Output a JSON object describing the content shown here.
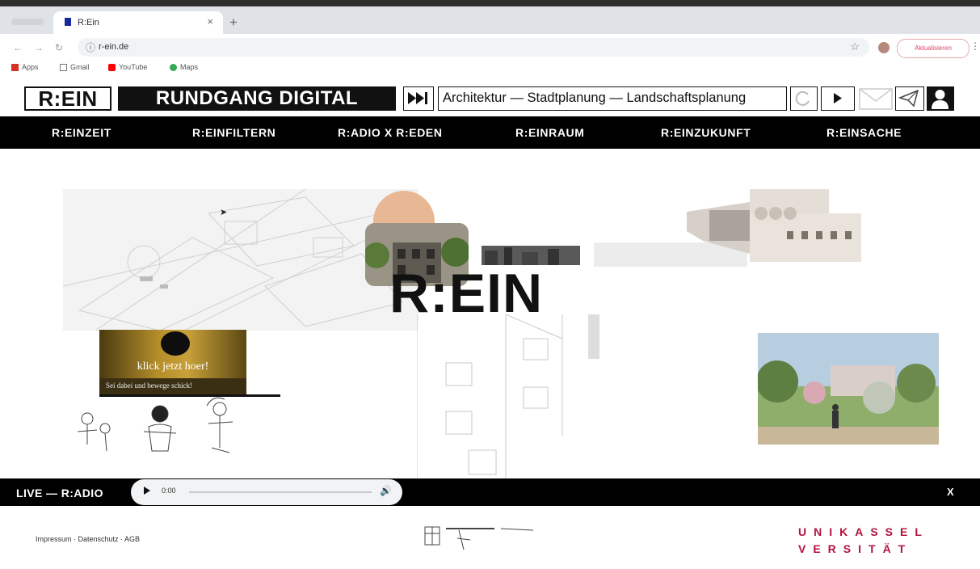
{
  "browser": {
    "tab_title": "R:Ein",
    "tab_close": "×",
    "new_tab": "+",
    "url": "r-ein.de",
    "update_button": "Aktualisieren",
    "bookmarks": [
      {
        "label": "Apps",
        "color": "#d93025"
      },
      {
        "label": "Gmail",
        "color": "#555555"
      },
      {
        "label": "YouTube",
        "color": "#ff0000"
      },
      {
        "label": "Maps",
        "color": "#34a853"
      }
    ]
  },
  "header": {
    "logo": "R:EIN",
    "title": "RUNDGANG DIGITAL",
    "marquee": "Architektur — Stadtplanung — Landschaftsplanung"
  },
  "nav": {
    "items": [
      "R:EINZEIT",
      "R:EINFILTERN",
      "R:ADIO X R:EDEN",
      "R:EINRAUM",
      "R:EINZUKUNFT",
      "R:EINSACHE"
    ]
  },
  "hero": {
    "logo": "R:EIN",
    "video_title": "klick jetzt hoer!",
    "video_subtitle": "Sei dabei und bewege schick!"
  },
  "radio": {
    "live_label": "LIVE — R:ADIO",
    "time": "0:00",
    "close": "X"
  },
  "footer": {
    "links": "Impressum · Datenschutz · AGB",
    "uni_line1": "UNIKASSEL",
    "uni_line2": "VERSITÄT"
  },
  "colors": {
    "brand_red": "#b3123e",
    "black": "#000000"
  }
}
